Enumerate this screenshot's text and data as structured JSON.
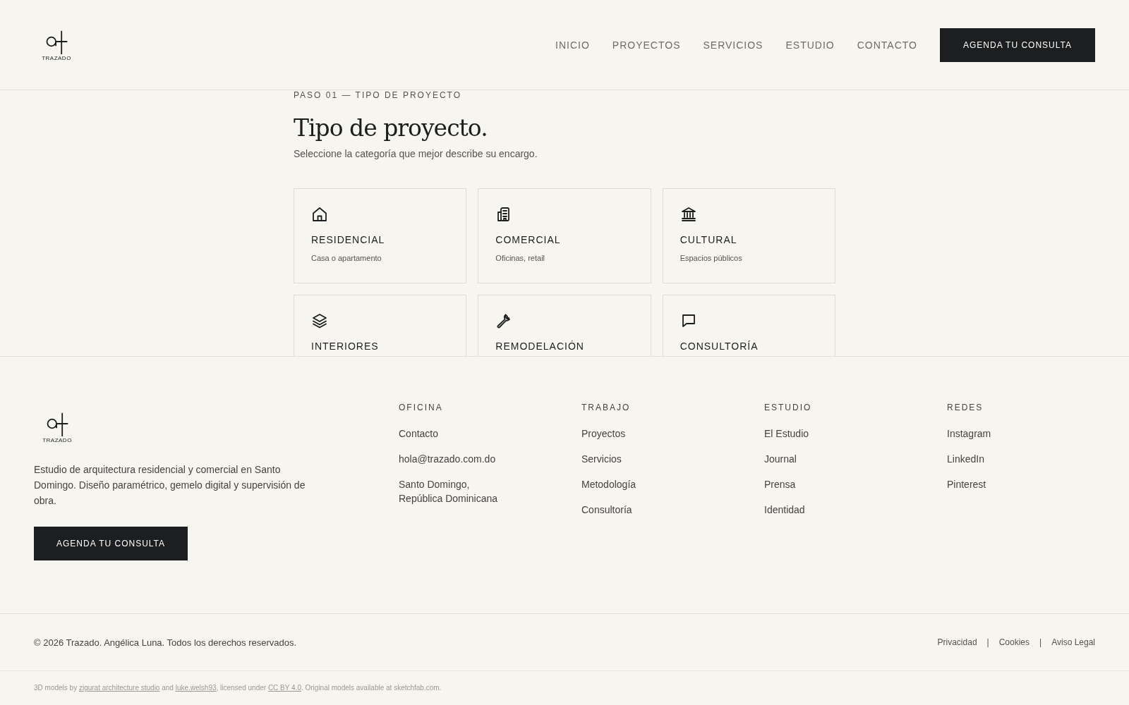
{
  "header": {
    "logo_text": "TRAZADO",
    "nav": [
      {
        "label": "INICIO"
      },
      {
        "label": "PROYECTOS"
      },
      {
        "label": "SERVICIOS"
      },
      {
        "label": "ESTUDIO"
      },
      {
        "label": "CONTACTO"
      }
    ],
    "cta": "AGENDA TU CONSULTA"
  },
  "step": {
    "eyebrow": "PASO 01 — TIPO DE PROYECTO",
    "title": "Tipo de proyecto.",
    "subtitle": "Seleccione la categoría que mejor describe su encargo.",
    "options": [
      {
        "title": "RESIDENCIAL",
        "description": "Casa o apartamento"
      },
      {
        "title": "COMERCIAL",
        "description": "Oficinas, retail"
      },
      {
        "title": "CULTURAL",
        "description": "Espacios públicos"
      },
      {
        "title": "INTERIORES"
      },
      {
        "title": "REMODELACIÓN"
      },
      {
        "title": "CONSULTORÍA"
      }
    ]
  },
  "footer": {
    "logo_text": "TRAZADO",
    "description": "Estudio de arquitectura residencial y comercial en Santo Domingo. Diseño paramétrico, gemelo digital y supervisión de obra.",
    "cta": "AGENDA TU CONSULTA",
    "columns": [
      {
        "heading": "OFICINA",
        "links": [
          "Contacto",
          "hola@trazado.com.do",
          "Santo Domingo, República Dominicana"
        ]
      },
      {
        "heading": "TRABAJO",
        "links": [
          "Proyectos",
          "Servicios",
          "Metodología",
          "Consultoría"
        ]
      },
      {
        "heading": "ESTUDIO",
        "links": [
          "El Estudio",
          "Journal",
          "Prensa",
          "Identidad"
        ]
      },
      {
        "heading": "REDES",
        "links": [
          "Instagram",
          "LinkedIn",
          "Pinterest"
        ]
      }
    ],
    "copyright": "© 2026 Trazado. Angélica Luna. Todos los derechos reservados.",
    "legal": [
      "Privacidad",
      "Cookies",
      "Aviso Legal"
    ],
    "separator": "|",
    "credits": [
      {
        "kind": "text",
        "text": "3D models by "
      },
      {
        "kind": "link",
        "text": "zigurat architecture studio"
      },
      {
        "kind": "text",
        "text": " and "
      },
      {
        "kind": "link",
        "text": "luke.welsh93"
      },
      {
        "kind": "text",
        "text": ", licensed under "
      },
      {
        "kind": "link",
        "text": "CC BY 4.0"
      },
      {
        "kind": "text",
        "text": ". Original models available at sketchfab.com."
      }
    ]
  }
}
